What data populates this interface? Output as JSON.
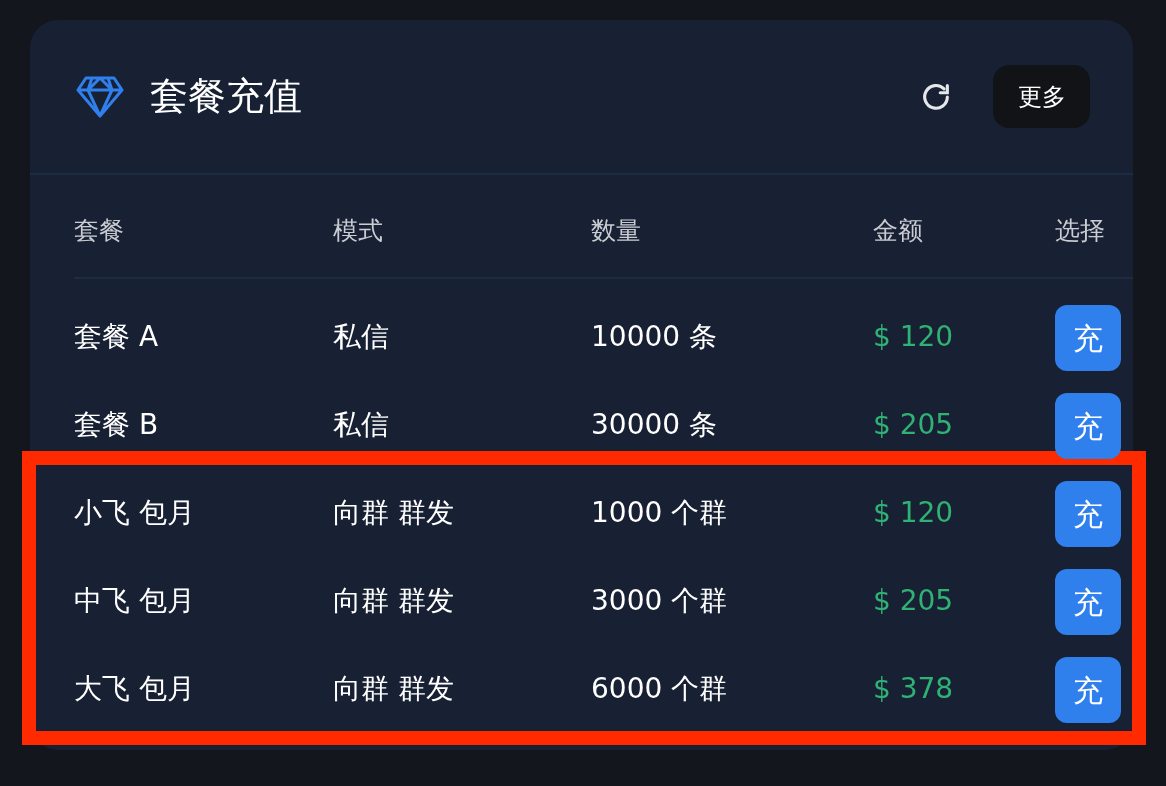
{
  "header": {
    "title": "套餐充值",
    "more_button": "更多"
  },
  "table": {
    "columns": [
      "套餐",
      "模式",
      "数量",
      "金额",
      "选择"
    ],
    "rows": [
      {
        "package": "套餐 A",
        "mode": "私信",
        "quantity": "10000 条",
        "amount": "$ 120",
        "action": "充",
        "highlighted": false
      },
      {
        "package": "套餐 B",
        "mode": "私信",
        "quantity": "30000 条",
        "amount": "$ 205",
        "action": "充",
        "highlighted": false
      },
      {
        "package": "小飞 包月",
        "mode": "向群 群发",
        "quantity": "1000 个群",
        "amount": "$ 120",
        "action": "充",
        "highlighted": true
      },
      {
        "package": "中飞 包月",
        "mode": "向群 群发",
        "quantity": "3000 个群",
        "amount": "$ 205",
        "action": "充",
        "highlighted": true
      },
      {
        "package": "大飞 包月",
        "mode": "向群 群发",
        "quantity": "6000 个群",
        "amount": "$ 378",
        "action": "充",
        "highlighted": true
      }
    ]
  }
}
